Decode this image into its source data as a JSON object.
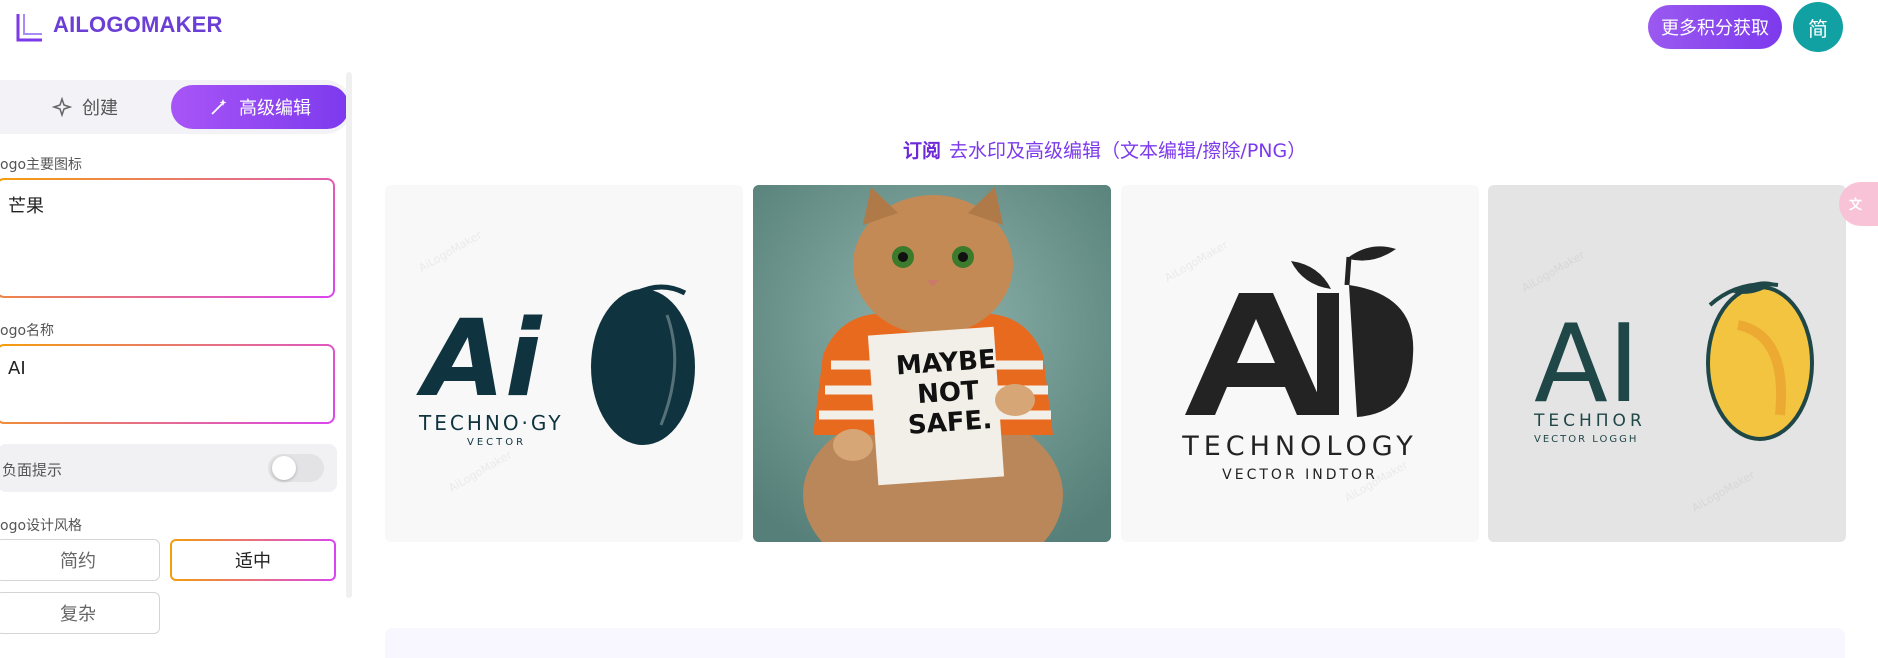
{
  "header": {
    "brand": "AILOGOMAKER",
    "credits_button": "更多积分获取",
    "lang_button": "简"
  },
  "sidebar": {
    "tabs": [
      {
        "label": "创建",
        "icon": "sparkle-icon",
        "active": false
      },
      {
        "label": "高级编辑",
        "icon": "magic-wand-icon",
        "active": true
      }
    ],
    "main_icon": {
      "label": "ogo主要图标",
      "value": "芒果"
    },
    "logo_name": {
      "label": "ogo名称",
      "value": "AI"
    },
    "negative_prompt": {
      "label": "负面提示",
      "enabled": false
    },
    "style": {
      "label": "ogo设计风格",
      "options": [
        "简约",
        "适中",
        "复杂"
      ],
      "selected": "适中"
    }
  },
  "main": {
    "subscribe": {
      "strong": "订阅",
      "text": "去水印及高级编辑（文本编辑/擦除/PNG）"
    },
    "watermark": "AiLogoMaker",
    "cards": [
      {
        "line1": "TECHNO·GY",
        "line2": "VECTOR"
      },
      {
        "sign": [
          "MAYBE",
          "NOT",
          "SAFE."
        ]
      },
      {
        "line1": "TECHNOLOGY",
        "line2": "VECTOR INDTOR"
      },
      {
        "line1": "TECHΠOR",
        "line2": "VECTOR LOGGH"
      }
    ]
  },
  "colors": {
    "brand": "#6b3fd6",
    "accent_gradient_start": "#a855f7",
    "accent_gradient_end": "#7c3aed",
    "lang_button": "#12a1a3",
    "logo_dark": "#0f3440"
  },
  "icons": [
    "sparkle-icon",
    "magic-wand-icon",
    "translate-icon",
    "logo-mark-icon"
  ]
}
